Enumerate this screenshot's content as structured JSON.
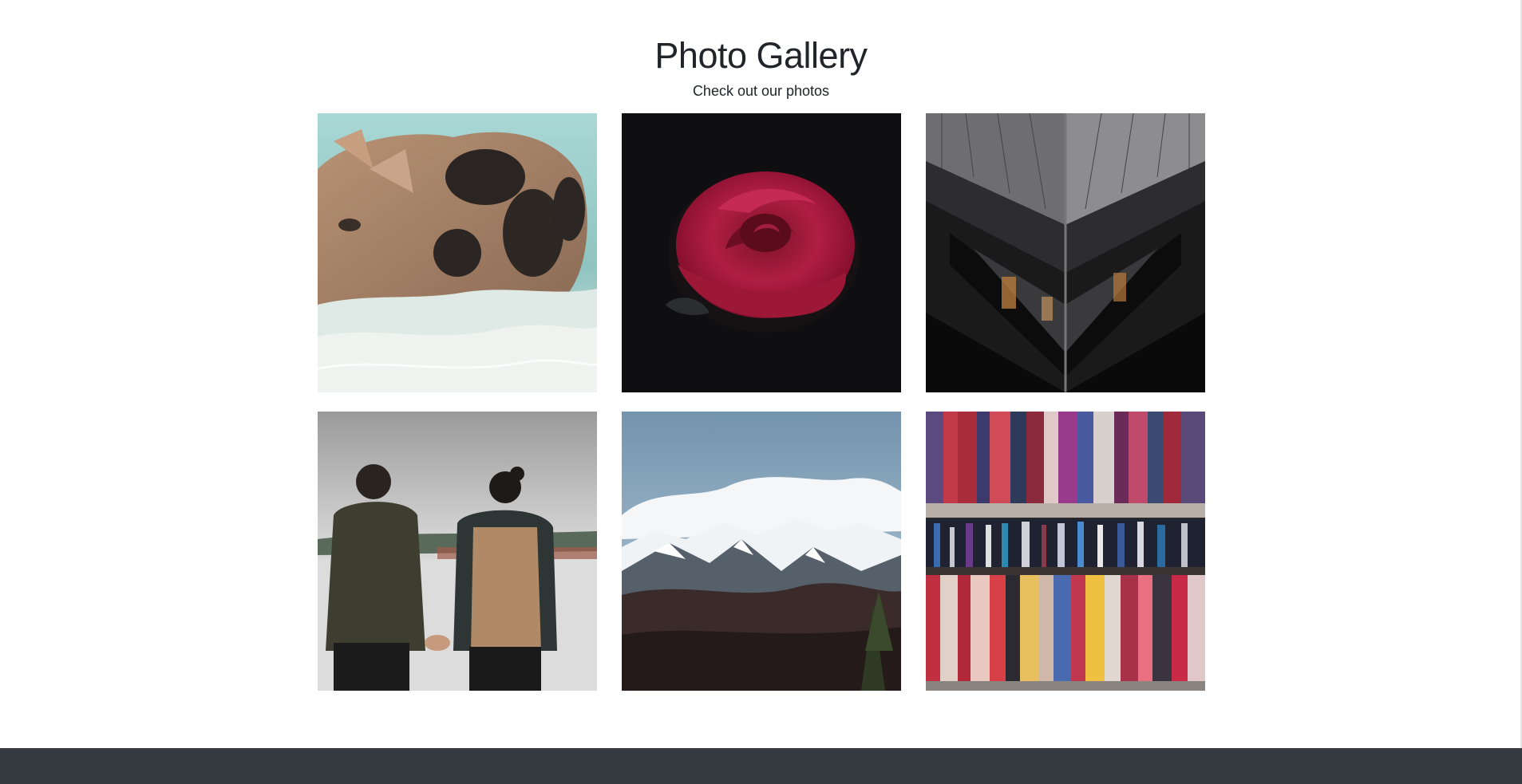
{
  "header": {
    "title": "Photo Gallery",
    "subtitle": "Check out our photos"
  },
  "gallery": {
    "photos": [
      {
        "icon": "pig-swimming-photo"
      },
      {
        "icon": "red-rose-photo"
      },
      {
        "icon": "skyscraper-facade-photo"
      },
      {
        "icon": "couple-holding-hands-photo"
      },
      {
        "icon": "snowy-mountains-photo"
      },
      {
        "icon": "library-bookshelf-photo"
      }
    ]
  },
  "colors": {
    "footer": "#343a40",
    "text": "#212529",
    "background": "#ffffff"
  }
}
